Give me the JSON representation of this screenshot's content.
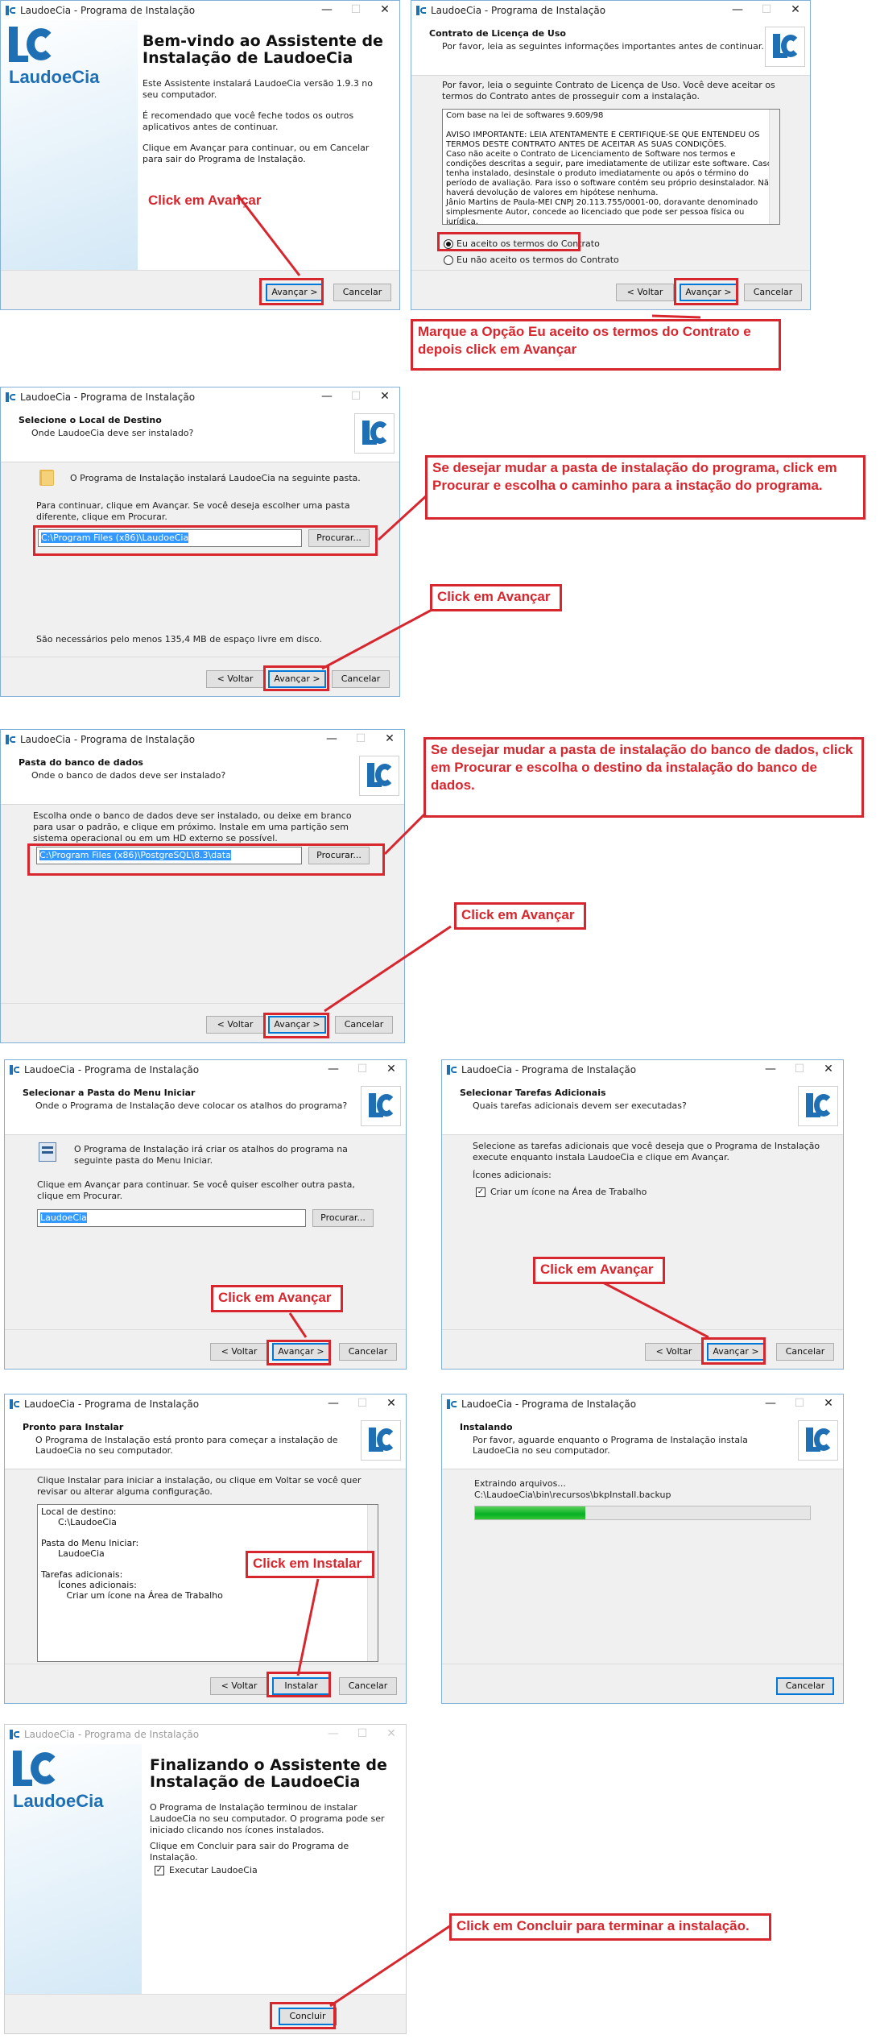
{
  "common": {
    "window_title": "LaudoeCia - Programa de Instalação",
    "minimize": "—",
    "maximize": "☐",
    "close": "✕",
    "back": "< Voltar",
    "next": "Avançar >",
    "cancel": "Cancelar",
    "browse": "Procurar..."
  },
  "w1": {
    "title": "Bem-vindo ao Assistente de Instalação de LaudoeCia",
    "logo_text": "LaudoeCia",
    "p1": "Este Assistente instalará LaudoeCia versão 1.9.3 no seu computador.",
    "p2": "É recomendado que você feche todos os outros aplicativos antes de continuar.",
    "p3": "Clique em Avançar para continuar, ou em Cancelar para sair do Programa de Instalação.",
    "callout": "Click em Avançar"
  },
  "w2": {
    "h1": "Contrato de Licença de Uso",
    "h2": "Por favor, leia as seguintes informações importantes antes de continuar.",
    "intro": "Por favor, leia o seguinte Contrato de Licença de Uso. Você deve aceitar os termos do Contrato antes de prosseguir com a instalação.",
    "license_lines": [
      "Com base na lei de softwares 9.609/98",
      "",
      "AVISO IMPORTANTE: LEIA ATENTAMENTE E CERTIFIQUE-SE QUE ENTENDEU OS TERMOS DESTE CONTRATO ANTES DE ACEITAR AS SUAS CONDIÇÕES.",
      "Caso não aceite o Contrato de Licenciamento de Software nos termos e condições descritas a seguir, pare imediatamente de utilizar este software. Caso tenha instalado, desinstale o produto imediatamente ou após o término do período de avaliação. Para isso o software contém seu próprio desinstalador. Não haverá devolução de valores em hipótese nenhuma.",
      "Jânio Martins de Paula-MEI CNPJ 20.113.755/0001-00, doravante denominado simplesmente Autor, concede ao licenciado que pode ser pessoa física ou jurídica,"
    ],
    "accept": "Eu aceito os termos do Contrato",
    "decline": "Eu não aceito os termos do Contrato",
    "callout": "Marque a Opção Eu aceito os termos do Contrato e depois click em Avançar"
  },
  "w3": {
    "h1": "Selecione o Local de Destino",
    "h2": "Onde LaudoeCia deve ser instalado?",
    "p1": "O Programa de Instalação instalará LaudoeCia na seguinte pasta.",
    "p2": "Para continuar, clique em Avançar. Se você deseja escolher uma pasta diferente, clique em Procurar.",
    "path": "C:\\Program Files (x86)\\LaudoeCia",
    "space": "São necessários pelo menos 135,4 MB de espaço livre em disco.",
    "callout1": "Se desejar mudar a pasta de instalação do programa, click em Procurar e escolha o caminho para a instação do programa.",
    "callout2": "Click em Avançar"
  },
  "w4": {
    "h1": "Pasta do banco de dados",
    "h2": "Onde o banco de dados deve ser instalado?",
    "p1": "Escolha onde o banco de dados deve ser instalado, ou deixe em branco para usar o padrão, e clique em próximo. Instale em uma partição sem sistema operacional ou em um HD externo se possível.",
    "path": "C:\\Program Files (x86)\\PostgreSQL\\8.3\\data",
    "callout1": "Se desejar mudar a pasta de instalação do banco de dados, click em Procurar e escolha o destino da instalação do banco de dados.",
    "callout2": "Click em Avançar"
  },
  "w5": {
    "h1": "Selecionar a Pasta do Menu Iniciar",
    "h2": "Onde o Programa de Instalação deve colocar os atalhos do programa?",
    "p1": "O Programa de Instalação irá criar os atalhos do programa na seguinte pasta do Menu Iniciar.",
    "p2": "Clique em Avançar para continuar. Se você quiser escolher outra pasta, clique em Procurar.",
    "folder": "LaudoeCia",
    "callout": "Click em Avançar"
  },
  "w6": {
    "h1": "Selecionar Tarefas Adicionais",
    "h2": "Quais tarefas adicionais devem ser executadas?",
    "p1": "Selecione as tarefas adicionais que você deseja que o Programa de Instalação execute enquanto instala LaudoeCia e clique em Avançar.",
    "group": "Ícones adicionais:",
    "task": "Criar um ícone na Área de Trabalho",
    "check": "✓",
    "callout": "Click em Avançar"
  },
  "w7": {
    "h1": "Pronto para Instalar",
    "h2": "O Programa de Instalação está pronto para começar a instalação de LaudoeCia no seu computador.",
    "p1": "Clique Instalar para iniciar a instalação, ou clique em Voltar se você quer revisar ou alterar alguma configuração.",
    "summary_lines": [
      "Local de destino:",
      "      C:\\LaudoeCia",
      "",
      "Pasta do Menu Iniciar:",
      "      LaudoeCia",
      "",
      "Tarefas adicionais:",
      "      Ícones adicionais:",
      "         Criar um ícone na Área de Trabalho"
    ],
    "install": "Instalar",
    "callout": "Click em Instalar"
  },
  "w8": {
    "h1": "Instalando",
    "h2": "Por favor, aguarde enquanto o Programa de Instalação instala LaudoeCia no seu computador.",
    "status": "Extraindo arquivos...",
    "file": "C:\\LaudoeCia\\bin\\recursos\\bkpInstall.backup",
    "progress": 0.33
  },
  "w9": {
    "title": "Finalizando o Assistente de Instalação de LaudoeCia",
    "logo_text": "LaudoeCia",
    "p1": "O Programa de Instalação terminou de instalar LaudoeCia no seu computador. O programa pode ser iniciado clicando nos ícones instalados.",
    "p2": "Clique em Concluir para sair do Programa de Instalação.",
    "run": "Executar LaudoeCia",
    "finish": "Concluir",
    "callout": "Click em Concluir para terminar a instalação."
  },
  "colors": {
    "accent": "#0078d7",
    "annotation_red": "#d7262e",
    "logo_blue": "#1f6fb5",
    "progress_green": "#06b025"
  }
}
